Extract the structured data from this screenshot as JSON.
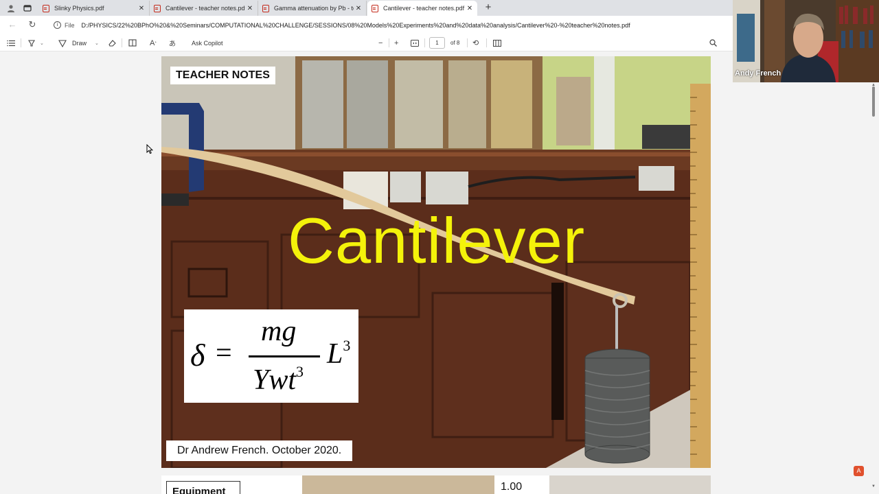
{
  "tabs": [
    {
      "title": "Slinky Physics.pdf",
      "active": false
    },
    {
      "title": "Cantilever - teacher notes.pdf",
      "active": false
    },
    {
      "title": "Gamma attenuation by Pb - teach",
      "active": false
    },
    {
      "title": "Cantilever - teacher notes.pdf",
      "active": true
    }
  ],
  "address": {
    "file_label": "File",
    "url": "D:/PHYSICS/22%20BPhO%20&%20Seminars/COMPUTATIONAL%20CHALLENGE/SESSIONS/08%20Models%20Experiments%20and%20data%20analysis/Cantilever%20-%20teacher%20notes.pdf"
  },
  "toolbar": {
    "draw_label": "Draw",
    "ask_copilot_label": "Ask Copilot",
    "page_number": "1",
    "page_of": "of 8"
  },
  "page1": {
    "badge": "TEACHER NOTES",
    "title": "Cantilever",
    "formula": {
      "lhs": "δ",
      "equals": "=",
      "numerator": "mg",
      "denominator": "Ywt",
      "denominator_exp": "3",
      "factor": "L",
      "factor_exp": "3"
    },
    "author": "Dr Andrew French. October 2020."
  },
  "page2": {
    "equipment_label": "Equipment",
    "value": "1.00"
  },
  "webcam": {
    "name": "Andy French"
  },
  "icons": {
    "profile": "profile-icon",
    "tab_actions": "tab-actions-icon",
    "pdf": "pdf-icon",
    "close": "close-icon",
    "new_tab": "plus-icon",
    "back": "back-arrow-icon",
    "refresh": "refresh-icon",
    "info": "info-icon",
    "contents": "contents-list-icon",
    "highlight": "highlight-icon",
    "draw": "draw-icon",
    "erase": "eraser-icon",
    "page_view": "page-view-icon",
    "read_aloud": "read-aloud-icon",
    "translate": "translate-icon",
    "zoom_out": "minus-icon",
    "zoom_in": "plus-icon",
    "fit": "fit-page-icon",
    "rotate": "rotate-icon",
    "two_page": "two-page-icon",
    "search": "search-icon",
    "acrobat": "acrobat-icon"
  },
  "colors": {
    "title_yellow": "#f4f20a",
    "pdf_red": "#c42b1c",
    "tabstrip": "#dfe1e5"
  }
}
